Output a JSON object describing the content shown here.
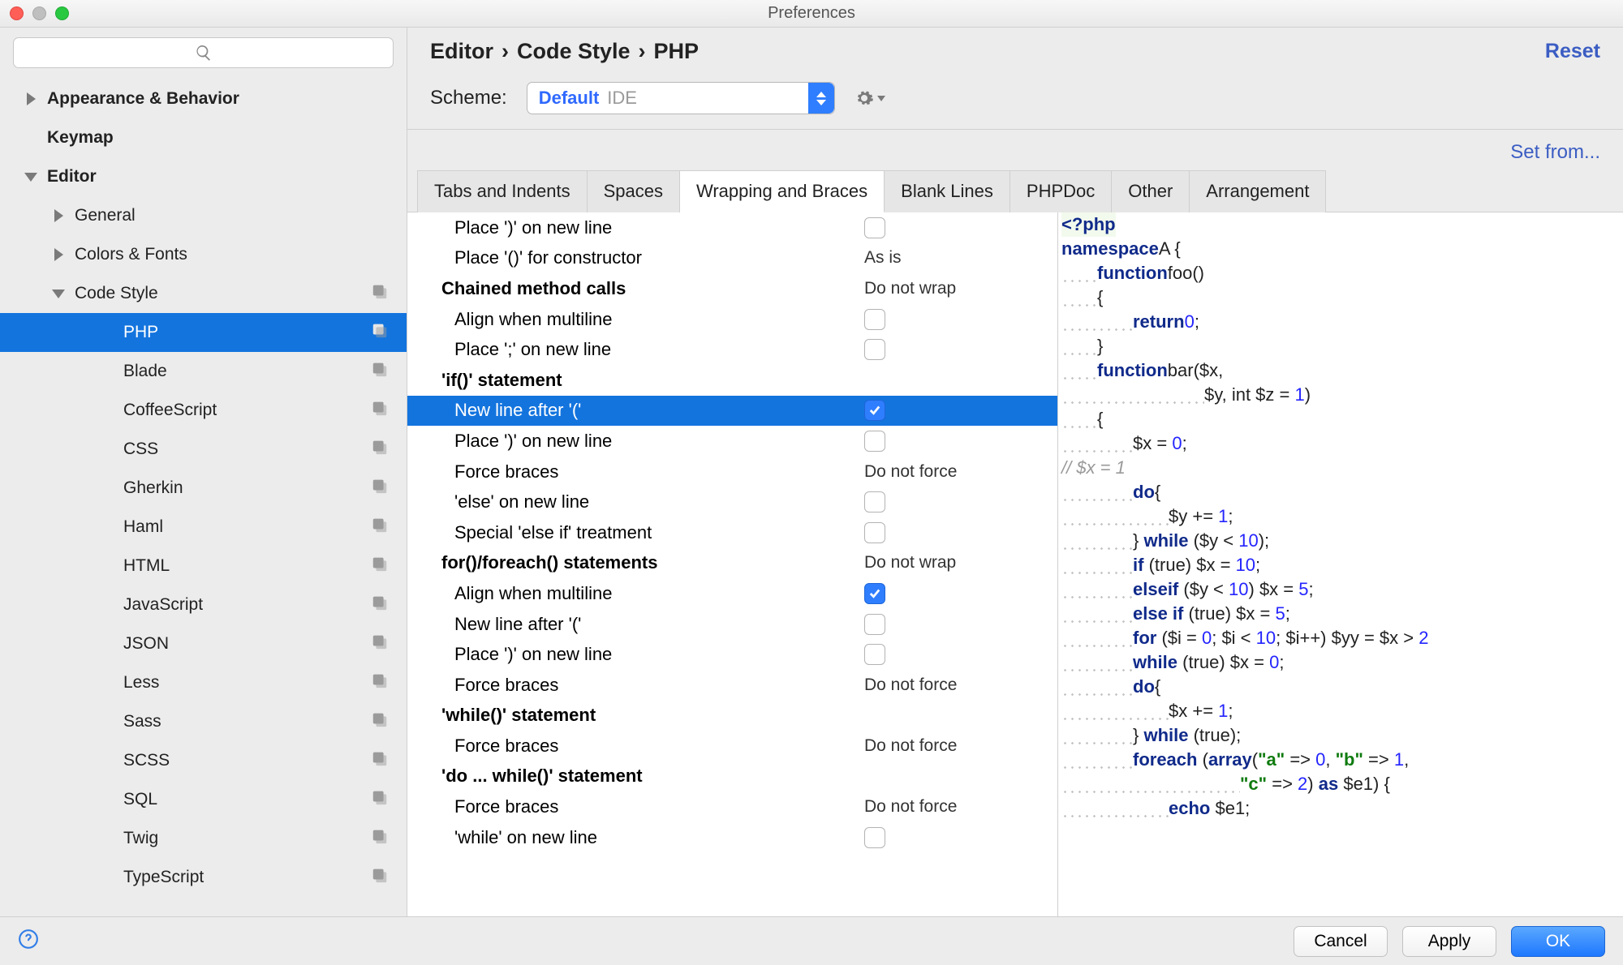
{
  "window": {
    "title": "Preferences"
  },
  "sidebar": {
    "search_placeholder": "",
    "items": [
      {
        "label": "Appearance & Behavior",
        "arrow": "right",
        "bold": true,
        "indent": 0
      },
      {
        "label": "Keymap",
        "arrow": "",
        "bold": true,
        "indent": 0
      },
      {
        "label": "Editor",
        "arrow": "down",
        "bold": true,
        "indent": 0
      },
      {
        "label": "General",
        "arrow": "right",
        "bold": false,
        "indent": 1
      },
      {
        "label": "Colors & Fonts",
        "arrow": "right",
        "bold": false,
        "indent": 1
      },
      {
        "label": "Code Style",
        "arrow": "down",
        "bold": false,
        "indent": 1,
        "badge": true
      },
      {
        "label": "PHP",
        "arrow": "",
        "bold": false,
        "indent": 3,
        "selected": true,
        "badge": true
      },
      {
        "label": "Blade",
        "arrow": "",
        "bold": false,
        "indent": 3,
        "badge": true
      },
      {
        "label": "CoffeeScript",
        "arrow": "",
        "bold": false,
        "indent": 3,
        "badge": true
      },
      {
        "label": "CSS",
        "arrow": "",
        "bold": false,
        "indent": 3,
        "badge": true
      },
      {
        "label": "Gherkin",
        "arrow": "",
        "bold": false,
        "indent": 3,
        "badge": true
      },
      {
        "label": "Haml",
        "arrow": "",
        "bold": false,
        "indent": 3,
        "badge": true
      },
      {
        "label": "HTML",
        "arrow": "",
        "bold": false,
        "indent": 3,
        "badge": true
      },
      {
        "label": "JavaScript",
        "arrow": "",
        "bold": false,
        "indent": 3,
        "badge": true
      },
      {
        "label": "JSON",
        "arrow": "",
        "bold": false,
        "indent": 3,
        "badge": true
      },
      {
        "label": "Less",
        "arrow": "",
        "bold": false,
        "indent": 3,
        "badge": true
      },
      {
        "label": "Sass",
        "arrow": "",
        "bold": false,
        "indent": 3,
        "badge": true
      },
      {
        "label": "SCSS",
        "arrow": "",
        "bold": false,
        "indent": 3,
        "badge": true
      },
      {
        "label": "SQL",
        "arrow": "",
        "bold": false,
        "indent": 3,
        "badge": true
      },
      {
        "label": "Twig",
        "arrow": "",
        "bold": false,
        "indent": 3,
        "badge": true
      },
      {
        "label": "TypeScript",
        "arrow": "",
        "bold": false,
        "indent": 3,
        "badge": true
      }
    ]
  },
  "header": {
    "breadcrumb": [
      "Editor",
      "Code Style",
      "PHP"
    ],
    "reset": "Reset",
    "scheme_label": "Scheme:",
    "scheme_name": "Default",
    "scheme_scope": "IDE",
    "set_from": "Set from..."
  },
  "tabs": [
    {
      "label": "Tabs and Indents"
    },
    {
      "label": "Spaces"
    },
    {
      "label": "Wrapping and Braces",
      "active": true
    },
    {
      "label": "Blank Lines"
    },
    {
      "label": "PHPDoc"
    },
    {
      "label": "Other"
    },
    {
      "label": "Arrangement"
    }
  ],
  "settings": [
    {
      "label": "Place ')' on new line",
      "type": "check",
      "checked": false
    },
    {
      "label": "Place '()' for constructor",
      "type": "text",
      "value": "As is"
    },
    {
      "label": "Chained method calls",
      "type": "group",
      "value": "Do not wrap"
    },
    {
      "label": "Align when multiline",
      "type": "check",
      "checked": false
    },
    {
      "label": "Place ';' on new line",
      "type": "check",
      "checked": false
    },
    {
      "label": "'if()' statement",
      "type": "group"
    },
    {
      "label": "New line after '('",
      "type": "check",
      "checked": true,
      "selected": true
    },
    {
      "label": "Place ')' on new line",
      "type": "check",
      "checked": false
    },
    {
      "label": "Force braces",
      "type": "text",
      "value": "Do not force"
    },
    {
      "label": "'else' on new line",
      "type": "check",
      "checked": false
    },
    {
      "label": "Special 'else if' treatment",
      "type": "check",
      "checked": false
    },
    {
      "label": "for()/foreach() statements",
      "type": "group",
      "value": "Do not wrap"
    },
    {
      "label": "Align when multiline",
      "type": "check",
      "checked": true
    },
    {
      "label": "New line after '('",
      "type": "check",
      "checked": false
    },
    {
      "label": "Place ')' on new line",
      "type": "check",
      "checked": false
    },
    {
      "label": "Force braces",
      "type": "text",
      "value": "Do not force"
    },
    {
      "label": "'while()' statement",
      "type": "group"
    },
    {
      "label": "Force braces",
      "type": "text",
      "value": "Do not force"
    },
    {
      "label": "'do ... while()' statement",
      "type": "group"
    },
    {
      "label": "Force braces",
      "type": "text",
      "value": "Do not force"
    },
    {
      "label": "'while' on new line",
      "type": "check",
      "checked": false
    }
  ],
  "footer": {
    "cancel": "Cancel",
    "apply": "Apply",
    "ok": "OK"
  }
}
